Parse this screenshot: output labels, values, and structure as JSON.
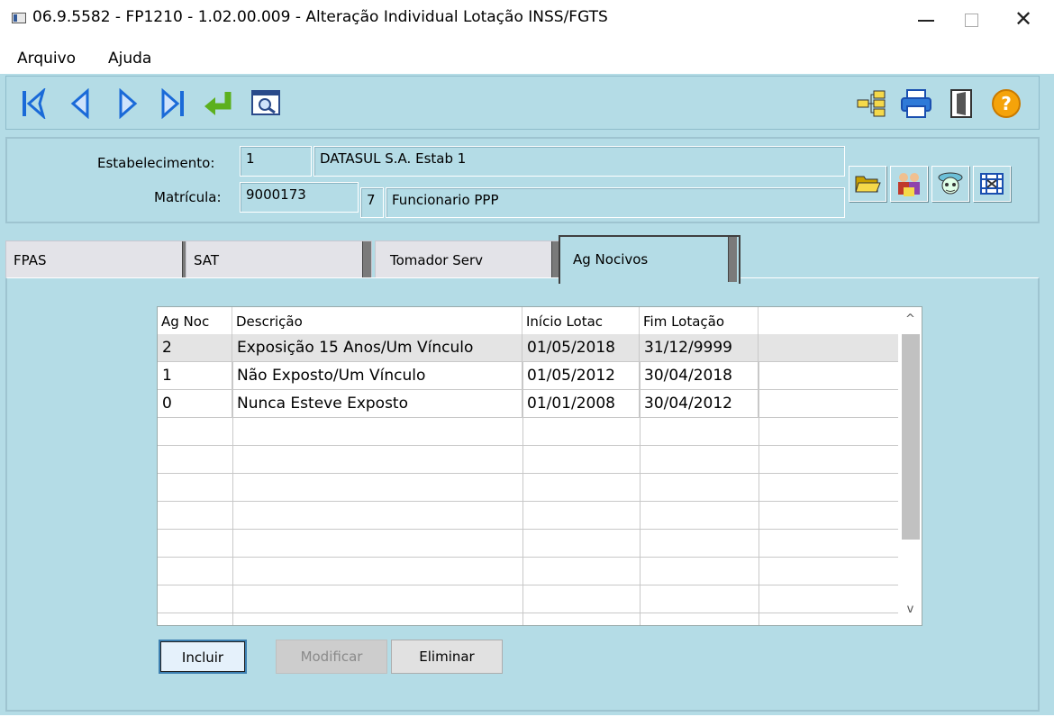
{
  "window": {
    "title": "06.9.5582 - FP1210 - 1.02.00.009 - Alteração Individual Lotação INSS/FGTS",
    "min_icon": "minimize-icon",
    "max_icon": "maximize-icon",
    "close_icon": "close-icon",
    "close_glyph": "✕"
  },
  "menu": {
    "items": [
      "Arquivo",
      "Ajuda"
    ]
  },
  "toolbar": {
    "left_icons": [
      "first-record-icon",
      "previous-record-icon",
      "next-record-icon",
      "last-record-icon",
      "goto-icon",
      "search-icon"
    ],
    "right_icons": [
      "tree-icon",
      "print-icon",
      "exit-icon",
      "help-icon"
    ],
    "colors": {
      "nav_blue": "#1a6ad8",
      "enter_green": "#5cb01e",
      "help_orange": "#f5a30a"
    }
  },
  "header": {
    "estab_label": "Estabelecimento:",
    "estab_code": "1",
    "estab_name": "DATASUL S.A. Estab 1",
    "matricula_label": "Matrícula:",
    "matricula": "9000173",
    "digit": "7",
    "funcionario": "Funcionario PPP",
    "buttons": [
      "folder-icon",
      "people-icon",
      "person-icon",
      "film-icon"
    ]
  },
  "tabs": [
    {
      "label": "FPAS",
      "active": false
    },
    {
      "label": "SAT",
      "active": false
    },
    {
      "label": "Tomador Serv",
      "active": false
    },
    {
      "label": "Ag Nocivos",
      "active": true
    }
  ],
  "grid": {
    "columns": [
      "Ag Noc",
      "Descrição",
      "Início Lotac",
      "Fim Lotação"
    ],
    "rows": [
      [
        "2",
        "Exposição 15 Anos/Um Vínculo",
        "01/05/2018",
        "31/12/9999"
      ],
      [
        "1",
        "Não Exposto/Um Vínculo",
        "01/05/2012",
        "30/04/2018"
      ],
      [
        "0",
        "Nunca Esteve Exposto",
        "01/01/2008",
        "30/04/2012"
      ]
    ],
    "selected_row": 0,
    "scroll_up": "^",
    "scroll_down": "v"
  },
  "buttons": {
    "incluir": "Incluir",
    "modificar": "Modificar",
    "eliminar": "Eliminar"
  }
}
